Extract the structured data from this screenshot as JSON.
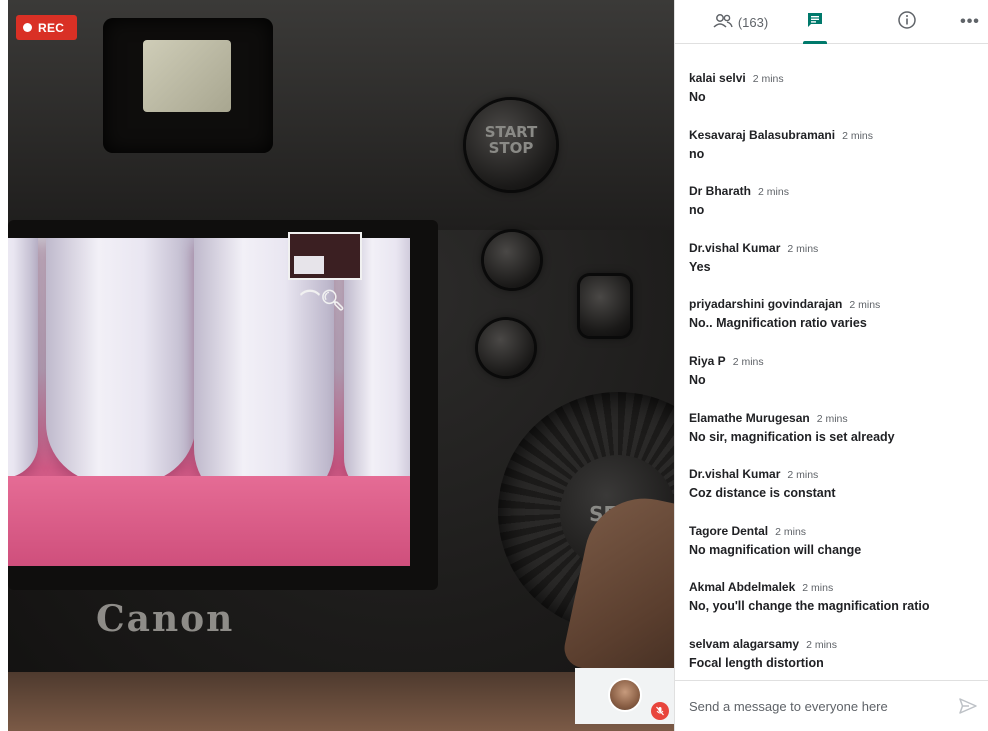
{
  "recording": {
    "label": "REC",
    "color": "#d93025"
  },
  "camera": {
    "brand_text": "Canon",
    "start_stop_label": "START\nSTOP",
    "set_label": "SET"
  },
  "tabs": {
    "people_count": "(163)",
    "people_icon": "people-icon",
    "chat_icon": "chat-icon",
    "info_icon": "info-icon",
    "more_icon": "more-icon",
    "accent": "#00796b"
  },
  "messages": [
    {
      "name": "kalai selvi",
      "time": "2 mins",
      "text": "No"
    },
    {
      "name": "Kesavaraj Balasubramani",
      "time": "2 mins",
      "text": "no"
    },
    {
      "name": "Dr Bharath",
      "time": "2 mins",
      "text": "no"
    },
    {
      "name": "Dr.vishal Kumar",
      "time": "2 mins",
      "text": "Yes"
    },
    {
      "name": "priyadarshini govindarajan",
      "time": "2 mins",
      "text": "No.. Magnification ratio varies"
    },
    {
      "name": "Riya P",
      "time": "2 mins",
      "text": "No"
    },
    {
      "name": "Elamathe Murugesan",
      "time": "2 mins",
      "text": "No sir, magnification is set already"
    },
    {
      "name": "Dr.vishal Kumar",
      "time": "2 mins",
      "text": "Coz distance is constant"
    },
    {
      "name": "Tagore Dental",
      "time": "2 mins",
      "text": "No magnification will change"
    },
    {
      "name": "Akmal Abdelmalek",
      "time": "2 mins",
      "text": "No, you'll change the magnification ratio"
    },
    {
      "name": "selvam alagarsamy",
      "time": "2 mins",
      "text": "Focal length distortion"
    }
  ],
  "composer": {
    "placeholder": "Send a message to everyone here",
    "send_icon": "send-icon"
  }
}
